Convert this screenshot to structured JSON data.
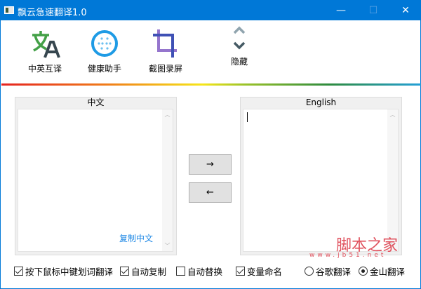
{
  "window": {
    "title": "飘云急速翻译1.0",
    "minimize": "—",
    "maximize": "☐",
    "close": "✕"
  },
  "toolbar": [
    {
      "label": "中英互译",
      "icon": "translate-icon"
    },
    {
      "label": "健康助手",
      "icon": "health-icon"
    },
    {
      "label": "截图录屏",
      "icon": "crop-icon"
    },
    {
      "label": "隐藏",
      "icon": "collapse-icon"
    }
  ],
  "left_panel": {
    "title": "中文",
    "value": "",
    "copy_link": "复制中文"
  },
  "right_panel": {
    "title": "English",
    "value": ""
  },
  "buttons": {
    "to_right": "→",
    "to_left": "←"
  },
  "options": {
    "middle_click": {
      "label": "按下鼠标中键划词翻译",
      "checked": true
    },
    "auto_copy": {
      "label": "自动复制",
      "checked": true
    },
    "auto_replace": {
      "label": "自动替换",
      "checked": false
    },
    "var_naming": {
      "label": "变量命名",
      "checked": true
    }
  },
  "engines": [
    {
      "label": "谷歌翻译",
      "selected": false
    },
    {
      "label": "金山翻译",
      "selected": true
    }
  ],
  "watermark": {
    "url": "www.jb51.net",
    "name": "脚本之家"
  },
  "colors": {
    "titlebar": "#0078d7",
    "link": "#1e88e5"
  }
}
